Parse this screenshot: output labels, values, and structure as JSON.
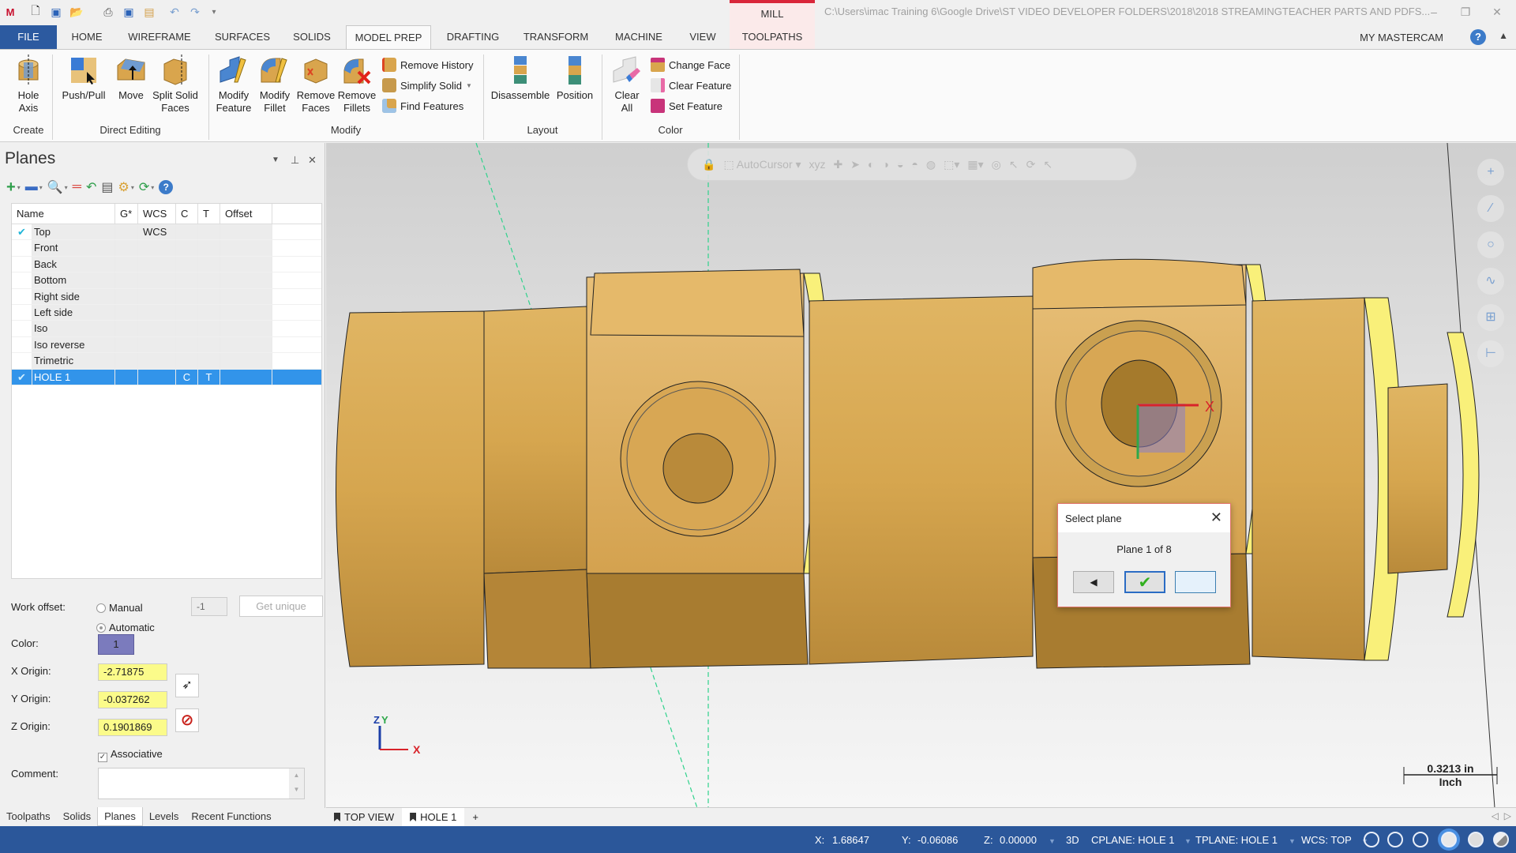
{
  "app": {
    "logo": "mastercam-18-logo",
    "context_tab": "MILL",
    "title_path": "C:\\Users\\imac Training 6\\Google Drive\\ST VIDEO DEVELOPER FOLDERS\\2018\\2018 STREAMINGTEACHER PARTS AND PDFS...",
    "window_controls": [
      "minimize",
      "restore",
      "close"
    ],
    "quick_access": [
      "new-file-icon",
      "save-icon",
      "open-icon",
      "print-icon",
      "save-as-icon",
      "file-props-icon",
      "undo-icon",
      "redo-icon",
      "customize-icon"
    ]
  },
  "ribbon": {
    "tabs": [
      "FILE",
      "HOME",
      "WIREFRAME",
      "SURFACES",
      "SOLIDS",
      "MODEL PREP",
      "DRAFTING",
      "TRANSFORM",
      "MACHINE",
      "VIEW",
      "TOOLPATHS"
    ],
    "active_tab": "MODEL PREP",
    "my_mastercam": "MY MASTERCAM",
    "groups": {
      "create": {
        "label": "Create",
        "buttons": [
          {
            "l1": "Hole",
            "l2": "Axis",
            "icon": "hole-axis-icon"
          }
        ]
      },
      "direct_editing": {
        "label": "Direct Editing",
        "buttons": [
          {
            "l1": "Push/Pull",
            "l2": "",
            "icon": "push-pull-icon"
          },
          {
            "l1": "Move",
            "l2": "",
            "icon": "move-icon"
          },
          {
            "l1": "Split Solid",
            "l2": "Faces",
            "icon": "split-solid-faces-icon"
          }
        ]
      },
      "modify": {
        "label": "Modify",
        "buttons": [
          {
            "l1": "Modify",
            "l2": "Feature",
            "icon": "modify-feature-icon"
          },
          {
            "l1": "Modify",
            "l2": "Fillet",
            "icon": "modify-fillet-icon"
          },
          {
            "l1": "Remove",
            "l2": "Faces",
            "icon": "remove-faces-icon"
          },
          {
            "l1": "Remove",
            "l2": "Fillets",
            "icon": "remove-fillets-icon"
          }
        ],
        "small": [
          "Remove History",
          "Simplify Solid",
          "Find Features"
        ]
      },
      "layout": {
        "label": "Layout",
        "buttons": [
          {
            "l1": "Disassemble",
            "l2": "",
            "icon": "disassemble-icon"
          },
          {
            "l1": "Position",
            "l2": "",
            "icon": "position-icon"
          }
        ]
      },
      "color": {
        "label": "Color",
        "buttons": [
          {
            "l1": "Clear",
            "l2": "All",
            "icon": "clear-all-icon"
          }
        ],
        "small": [
          "Change Face",
          "Clear Feature",
          "Set Feature"
        ]
      }
    }
  },
  "planes_panel": {
    "title": "Planes",
    "columns": [
      "Name",
      "G*",
      "WCS",
      "C",
      "T",
      "Offset"
    ],
    "rows": [
      {
        "check": "✔",
        "name": "Top",
        "g": "",
        "wcs": "WCS",
        "c": "",
        "t": "",
        "offset": ""
      },
      {
        "check": "",
        "name": "Front",
        "g": "",
        "wcs": "",
        "c": "",
        "t": "",
        "offset": ""
      },
      {
        "check": "",
        "name": "Back",
        "g": "",
        "wcs": "",
        "c": "",
        "t": "",
        "offset": ""
      },
      {
        "check": "",
        "name": "Bottom",
        "g": "",
        "wcs": "",
        "c": "",
        "t": "",
        "offset": ""
      },
      {
        "check": "",
        "name": "Right side",
        "g": "",
        "wcs": "",
        "c": "",
        "t": "",
        "offset": ""
      },
      {
        "check": "",
        "name": "Left side",
        "g": "",
        "wcs": "",
        "c": "",
        "t": "",
        "offset": ""
      },
      {
        "check": "",
        "name": "Iso",
        "g": "",
        "wcs": "",
        "c": "",
        "t": "",
        "offset": ""
      },
      {
        "check": "",
        "name": "Iso reverse",
        "g": "",
        "wcs": "",
        "c": "",
        "t": "",
        "offset": ""
      },
      {
        "check": "",
        "name": "Trimetric",
        "g": "",
        "wcs": "",
        "c": "",
        "t": "",
        "offset": ""
      },
      {
        "check": "✔",
        "name": "HOLE 1",
        "g": "",
        "wcs": "",
        "c": "C",
        "t": "T",
        "offset": "",
        "selected": true
      }
    ],
    "work_offset_label": "Work offset:",
    "work_offset_options": [
      "Manual",
      "Automatic"
    ],
    "work_offset_selected": "Automatic",
    "work_offset_value": "-1",
    "get_unique_label": "Get unique",
    "color_label": "Color:",
    "color_value": "1",
    "color_swatch": "#7b7bbd",
    "x_origin_label": "X Origin:",
    "x_origin": "-2.71875",
    "y_origin_label": "Y Origin:",
    "y_origin": "-0.037262",
    "z_origin_label": "Z Origin:",
    "z_origin": "0.1901869",
    "associative_label": "Associative",
    "associative_checked": true,
    "comment_label": "Comment:",
    "comment_value": ""
  },
  "bottom_tabs": [
    "Toolpaths",
    "Solids",
    "Planes",
    "Levels",
    "Recent Functions"
  ],
  "bottom_tab_active": "Planes",
  "viewport": {
    "autocursor_label": "AutoCursor",
    "view_tabs": [
      "TOP VIEW",
      "HOLE 1"
    ],
    "active_view_tab": "HOLE 1",
    "add_tab": "+",
    "scale_value": "0.3213 in",
    "scale_unit": "Inch",
    "axis_labels": {
      "x": "X",
      "y": "Y",
      "z": "Z"
    },
    "solid_color": "#d6a64f"
  },
  "dialog": {
    "title": "Select plane",
    "count": "Plane 1 of 8",
    "buttons": [
      "previous",
      "ok",
      "next"
    ]
  },
  "statusbar": {
    "x_label": "X:",
    "x": "1.68647",
    "y_label": "Y:",
    "y": "-0.06086",
    "z_label": "Z:",
    "z": "0.00000",
    "mode": "3D",
    "cplane": "CPLANE: HOLE 1",
    "tplane": "TPLANE: HOLE 1",
    "wcs": "WCS: TOP"
  }
}
